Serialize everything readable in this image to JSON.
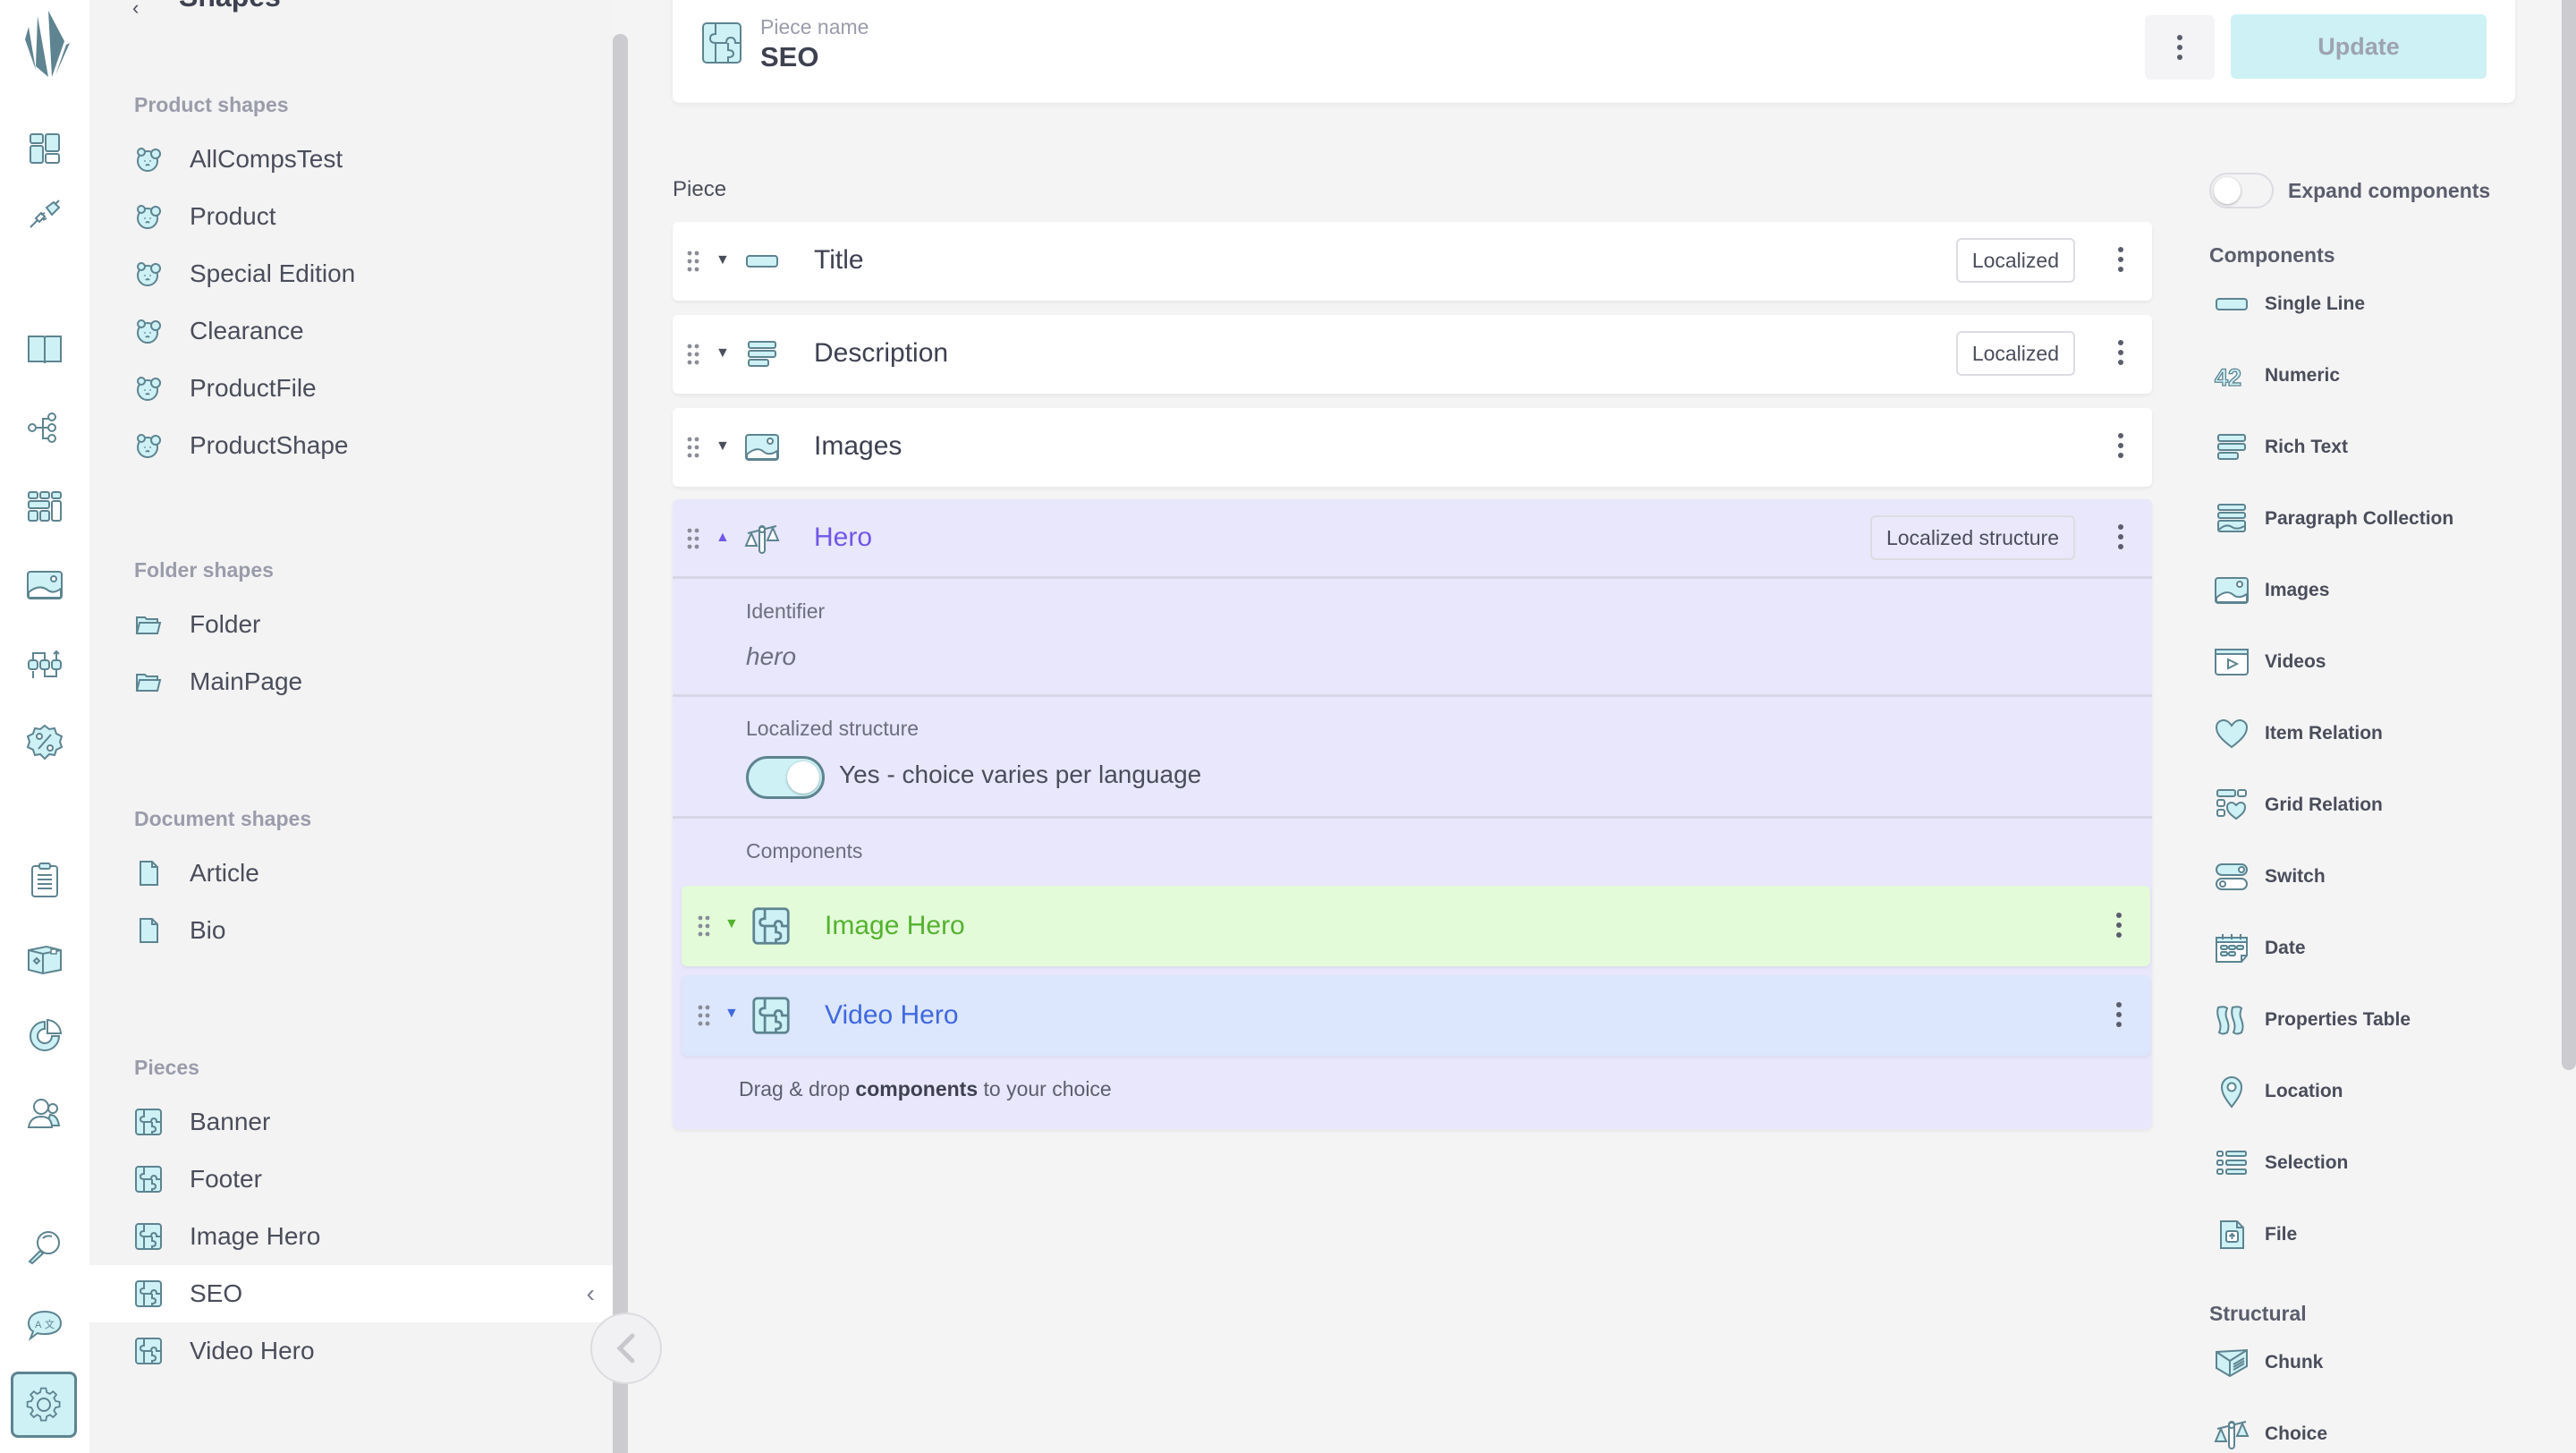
{
  "sidebar": {
    "title": "Shapes",
    "back_icon": "chevron-left-icon",
    "add_icon": "plus-icon",
    "sections": [
      {
        "label": "Product shapes",
        "icon": "product-shape-icon",
        "items": [
          "AllCompsTest",
          "Product",
          "Special Edition",
          "Clearance",
          "ProductFile",
          "ProductShape"
        ]
      },
      {
        "label": "Folder shapes",
        "icon": "folder-icon",
        "items": [
          "Folder",
          "MainPage"
        ]
      },
      {
        "label": "Document shapes",
        "icon": "document-icon",
        "items": [
          "Article",
          "Bio"
        ]
      },
      {
        "label": "Pieces",
        "icon": "piece-icon",
        "items": [
          "Banner",
          "Footer",
          "Image Hero",
          "SEO",
          "Video Hero"
        ]
      }
    ],
    "active_item": "SEO"
  },
  "rail": {
    "icons": [
      "dashboard-icon",
      "plug-icon",
      "catalogue-book-icon",
      "tree-icon",
      "grid-icon",
      "image-icon",
      "flow-icon",
      "discount-icon",
      "orders-icon",
      "product-box-icon",
      "analytics-icon",
      "customers-icon",
      "search-icon",
      "translate-icon",
      "settings-icon"
    ],
    "active": "settings-icon"
  },
  "header": {
    "label": "Piece name",
    "name": "SEO",
    "update_label": "Update"
  },
  "piece": {
    "label": "Piece",
    "rows": [
      {
        "name": "Title",
        "icon": "single-line-icon",
        "badge": "Localized"
      },
      {
        "name": "Description",
        "icon": "rich-text-icon",
        "badge": "Localized"
      },
      {
        "name": "Images",
        "icon": "images-icon",
        "badge": null
      }
    ],
    "hero": {
      "name": "Hero",
      "icon": "choice-icon",
      "badge": "Localized structure",
      "identifier_label": "Identifier",
      "identifier_value": "hero",
      "localized_label": "Localized structure",
      "localized_toggle_on": true,
      "localized_text": "Yes - choice varies per language",
      "components_label": "Components",
      "components": [
        {
          "name": "Image Hero",
          "icon": "piece-icon",
          "color": "#54b230",
          "bg": "#e3fbd9"
        },
        {
          "name": "Video Hero",
          "icon": "piece-icon",
          "color": "#3f68e0",
          "bg": "#dce6fc"
        }
      ],
      "drop_hint_pre": "Drag & drop ",
      "drop_hint_bold": "components",
      "drop_hint_post": " to your choice"
    }
  },
  "right_panel": {
    "expand_label": "Expand components",
    "expand_on": false,
    "components_label": "Components",
    "components": [
      {
        "label": "Single Line",
        "icon": "single-line-icon"
      },
      {
        "label": "Numeric",
        "icon": "numeric-icon"
      },
      {
        "label": "Rich Text",
        "icon": "rich-text-icon"
      },
      {
        "label": "Paragraph Collection",
        "icon": "paragraph-collection-icon"
      },
      {
        "label": "Images",
        "icon": "images-icon"
      },
      {
        "label": "Videos",
        "icon": "videos-icon"
      },
      {
        "label": "Item Relation",
        "icon": "heart-icon"
      },
      {
        "label": "Grid Relation",
        "icon": "grid-relation-icon"
      },
      {
        "label": "Switch",
        "icon": "switch-icon"
      },
      {
        "label": "Date",
        "icon": "calendar-icon"
      },
      {
        "label": "Properties Table",
        "icon": "properties-table-icon"
      },
      {
        "label": "Location",
        "icon": "location-pin-icon"
      },
      {
        "label": "Selection",
        "icon": "selection-list-icon"
      },
      {
        "label": "File",
        "icon": "file-upload-icon"
      }
    ],
    "structural_label": "Structural",
    "structural": [
      {
        "label": "Chunk",
        "icon": "chunk-icon"
      },
      {
        "label": "Choice",
        "icon": "choice-icon"
      }
    ]
  },
  "colors": {
    "accent": "#cdf1f5",
    "icon_stroke": "#5d8490",
    "hero_bg": "#e9e7fb",
    "hero_title": "#7257e8"
  }
}
